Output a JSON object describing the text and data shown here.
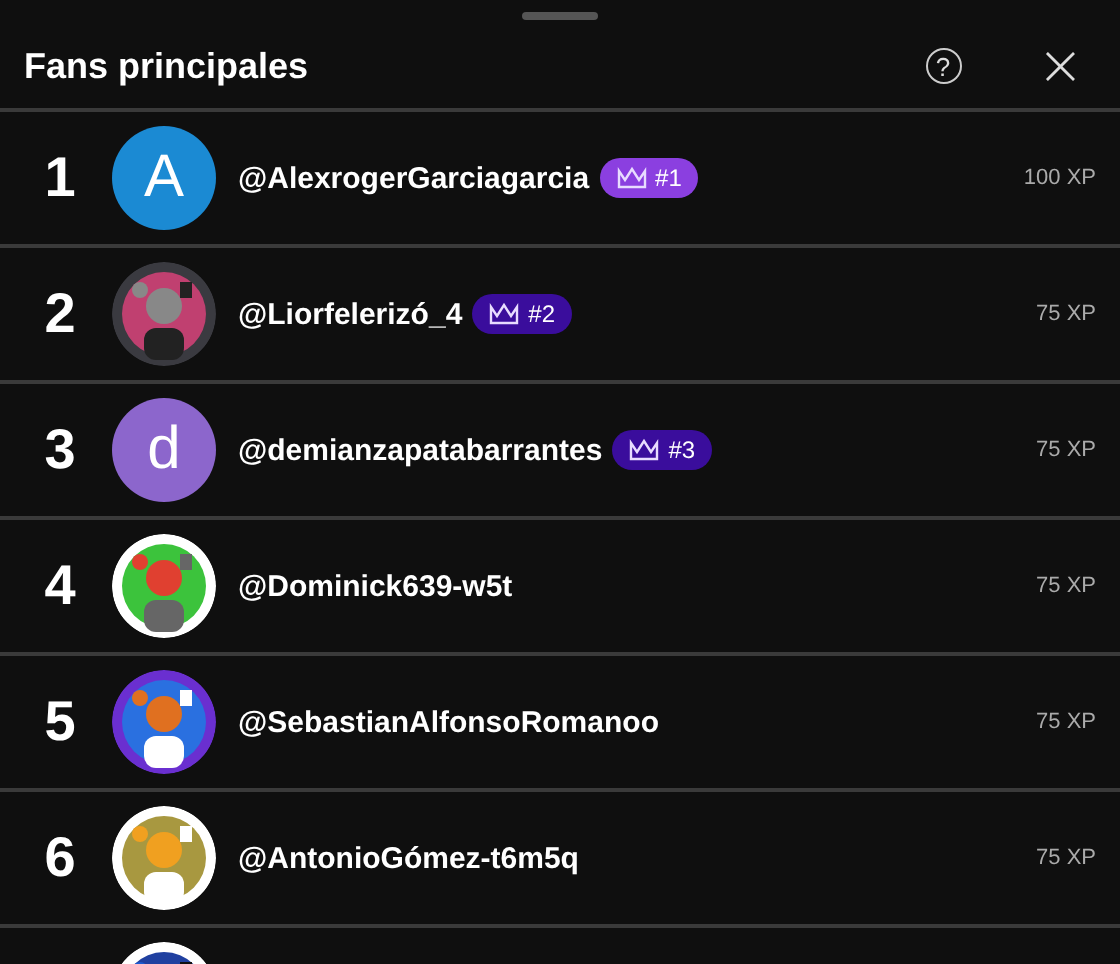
{
  "header": {
    "title": "Fans principales",
    "help_icon_text": "?",
    "close_icon_text": "×"
  },
  "rows": [
    {
      "rank": "1",
      "avatar": {
        "kind": "letter",
        "letter": "A",
        "color": "#1b8ad3"
      },
      "handle": "@AlexrogerGarciagarcia",
      "badge": {
        "label": "#1",
        "color": "#8b3fe0"
      },
      "xp": "100 XP"
    },
    {
      "rank": "2",
      "avatar": {
        "kind": "picture"
      },
      "handle": "@Liorfelerizó_4",
      "badge": {
        "label": "#2",
        "color": "#3a0d9c"
      },
      "xp": "75 XP"
    },
    {
      "rank": "3",
      "avatar": {
        "kind": "letter",
        "letter": "d",
        "color": "#8c66cc"
      },
      "handle": "@demianzapatabarrantes",
      "badge": {
        "label": "#3",
        "color": "#3a0d9c"
      },
      "xp": "75 XP"
    },
    {
      "rank": "4",
      "avatar": {
        "kind": "picture"
      },
      "handle": "@Dominick639-w5t",
      "xp": "75 XP"
    },
    {
      "rank": "5",
      "avatar": {
        "kind": "picture"
      },
      "handle": "@SebastianAlfonsoRomanoo",
      "xp": "75 XP"
    },
    {
      "rank": "6",
      "avatar": {
        "kind": "picture"
      },
      "handle": "@AntonioGómez-t6m5q",
      "xp": "75 XP"
    },
    {
      "avatar": {
        "kind": "picture"
      }
    }
  ]
}
